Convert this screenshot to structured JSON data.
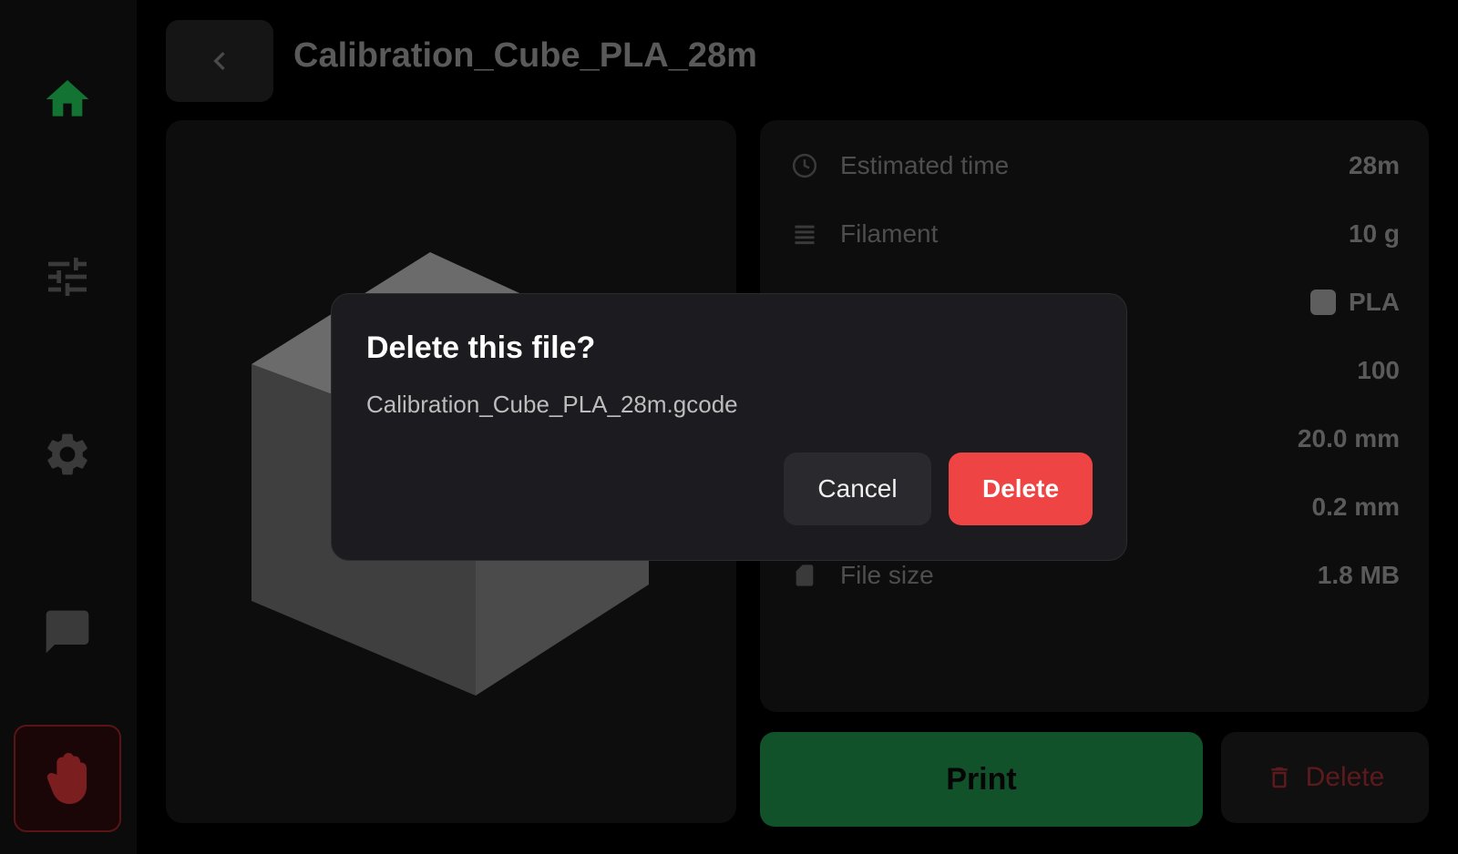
{
  "sidebar": {
    "items": [
      {
        "name": "home",
        "icon": "home-icon",
        "color": "#137333"
      },
      {
        "name": "controls",
        "icon": "sliders-icon",
        "color": "#3a3a3a"
      },
      {
        "name": "settings",
        "icon": "gear-icon",
        "color": "#3a3a3a"
      },
      {
        "name": "console",
        "icon": "chat-icon",
        "color": "#3a3a3a"
      },
      {
        "name": "emergency-stop",
        "icon": "hand-stop-icon",
        "color": "#7a1e20"
      }
    ]
  },
  "header": {
    "title": "Calibration_Cube_PLA_28m",
    "back_icon": "chevron-left-icon"
  },
  "info": {
    "rows": [
      {
        "icon": "clock-icon",
        "label": "Estimated time",
        "value": "28m"
      },
      {
        "icon": "filament-icon",
        "label": "Filament",
        "value": "10 g"
      },
      {
        "icon": "material-icon",
        "label": "",
        "value": "PLA"
      },
      {
        "icon": "",
        "label": "",
        "value": "100"
      },
      {
        "icon": "",
        "label": "",
        "value": "20.0 mm"
      },
      {
        "icon": "",
        "label": "",
        "value": "0.2 mm"
      },
      {
        "icon": "sd-card-icon",
        "label": "File size",
        "value": "1.8 MB"
      }
    ]
  },
  "actions": {
    "print_label": "Print",
    "delete_label": "Delete"
  },
  "dialog": {
    "title": "Delete this file?",
    "filename": "Calibration_Cube_PLA_28m.gcode",
    "cancel_label": "Cancel",
    "confirm_label": "Delete"
  },
  "colors": {
    "accent_green": "#137333",
    "danger_red": "#ef4444"
  }
}
